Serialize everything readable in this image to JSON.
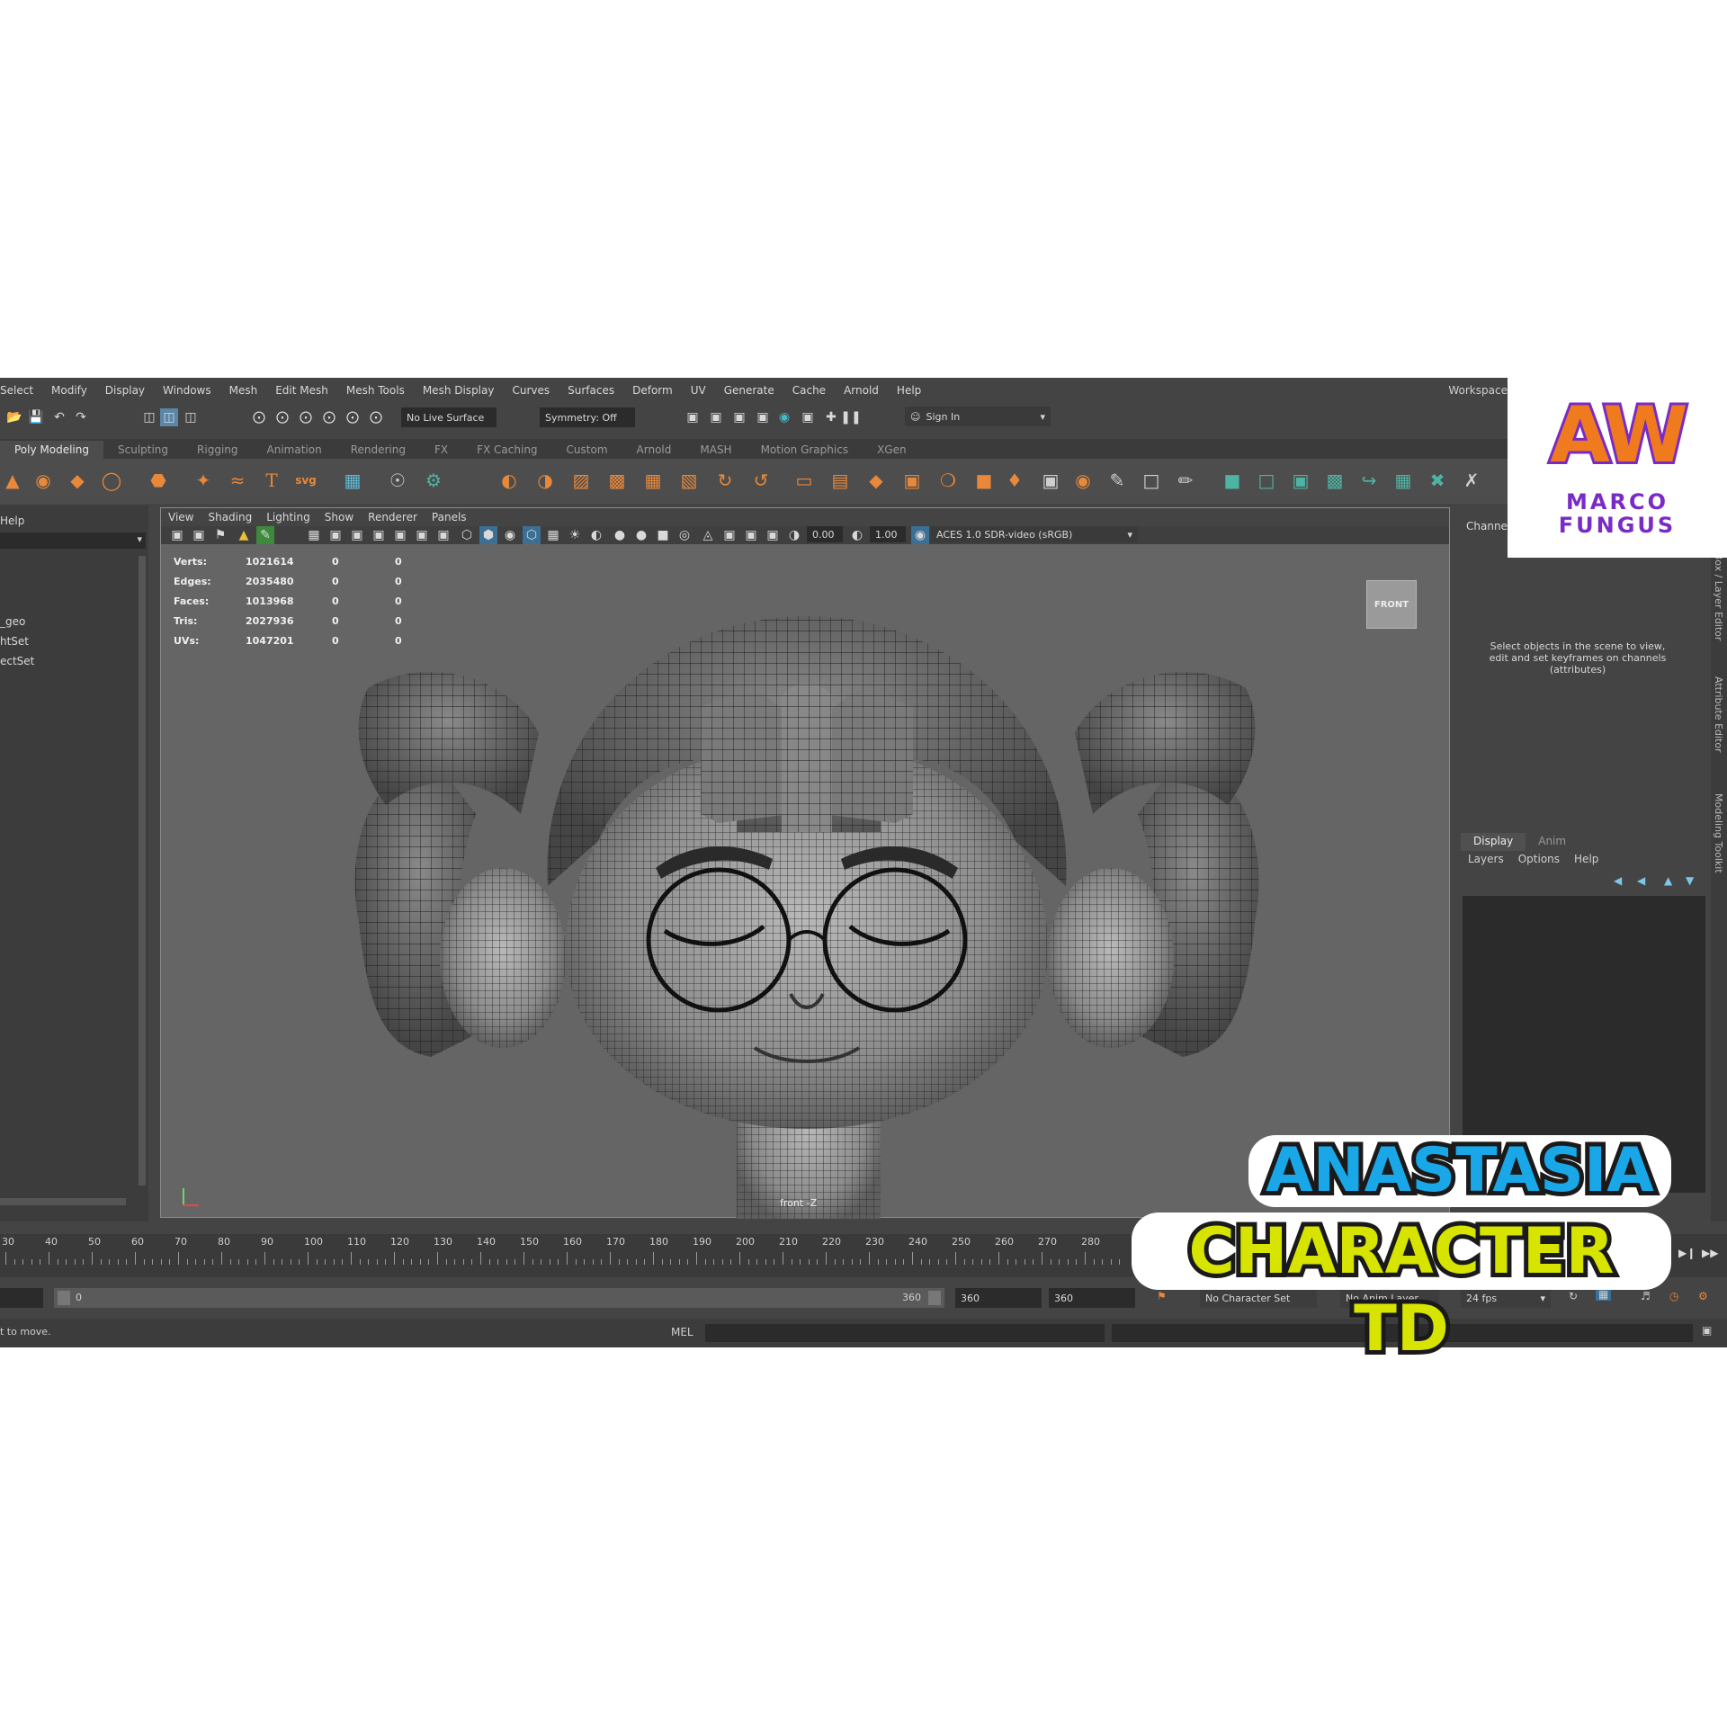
{
  "menu": [
    "Select",
    "Modify",
    "Display",
    "Windows",
    "Mesh",
    "Edit Mesh",
    "Mesh Tools",
    "Mesh Display",
    "Curves",
    "Surfaces",
    "Deform",
    "UV",
    "Generate",
    "Cache",
    "Arnold",
    "Help"
  ],
  "workspace_label": "Workspace:",
  "status": {
    "live_surface": "No Live Surface",
    "symmetry": "Symmetry: Off",
    "sign_in": "Sign In"
  },
  "shelf_tabs": [
    "Poly Modeling",
    "Sculpting",
    "Rigging",
    "Animation",
    "Rendering",
    "FX",
    "FX Caching",
    "Custom",
    "Arnold",
    "MASH",
    "Motion Graphics",
    "XGen"
  ],
  "shelf_text_icons": {
    "type": "T",
    "svg": "svg"
  },
  "outliner": {
    "menu_help": "Help",
    "items": [
      "_geo",
      "htSet",
      "ectSet"
    ]
  },
  "viewport": {
    "menu": [
      "View",
      "Shading",
      "Lighting",
      "Show",
      "Renderer",
      "Panels"
    ],
    "exposure": "0.00",
    "gamma": "1.00",
    "color_space": "ACES 1.0 SDR-video (sRGB)",
    "camera_label": "front -Z",
    "viewcube": "FRONT",
    "hud": [
      {
        "label": "Verts:",
        "v1": "1021614",
        "v2": "0",
        "v3": "0"
      },
      {
        "label": "Edges:",
        "v1": "2035480",
        "v2": "0",
        "v3": "0"
      },
      {
        "label": "Faces:",
        "v1": "1013968",
        "v2": "0",
        "v3": "0"
      },
      {
        "label": "Tris:",
        "v1": "2027936",
        "v2": "0",
        "v3": "0"
      },
      {
        "label": "UVs:",
        "v1": "1047201",
        "v2": "0",
        "v3": "0"
      }
    ]
  },
  "channel_box": {
    "title": "Channel",
    "hint": "Select objects in the scene to view, edit and set keyframes on channels (attributes)",
    "layer_tabs": [
      "Display",
      "Anim"
    ],
    "layer_menu": [
      "Layers",
      "Options",
      "Help"
    ]
  },
  "side_tabs": [
    "Channel Box / Layer Editor",
    "Attribute Editor",
    "Modeling Toolkit"
  ],
  "timeline": {
    "ticks": [
      "30",
      "40",
      "50",
      "60",
      "70",
      "80",
      "90",
      "100",
      "110",
      "120",
      "130",
      "140",
      "150",
      "160",
      "170",
      "180",
      "190",
      "200",
      "210",
      "220",
      "230",
      "240",
      "250",
      "260",
      "270",
      "280"
    ]
  },
  "range": {
    "start": "0",
    "slider_end": "360",
    "end1": "360",
    "end2": "360",
    "character_set": "No Character Set",
    "anim_layer": "No Anim Layer",
    "fps": "24 fps"
  },
  "command": {
    "help_text": "t to move.",
    "language": "MEL"
  },
  "logo": {
    "initials": "AW",
    "line1": "MARCO",
    "line2": "FUNGUS"
  },
  "overlay": {
    "line1": "ANASTASIA",
    "line2": "CHARACTER TD"
  },
  "colors": {
    "accent_orange": "#e8883a",
    "accent_teal": "#4fb3a4",
    "logo_orange": "#f07a1e",
    "logo_purple": "#7a2bc6",
    "title_blue": "#1aa7e8",
    "title_yellow": "#d7e400"
  }
}
